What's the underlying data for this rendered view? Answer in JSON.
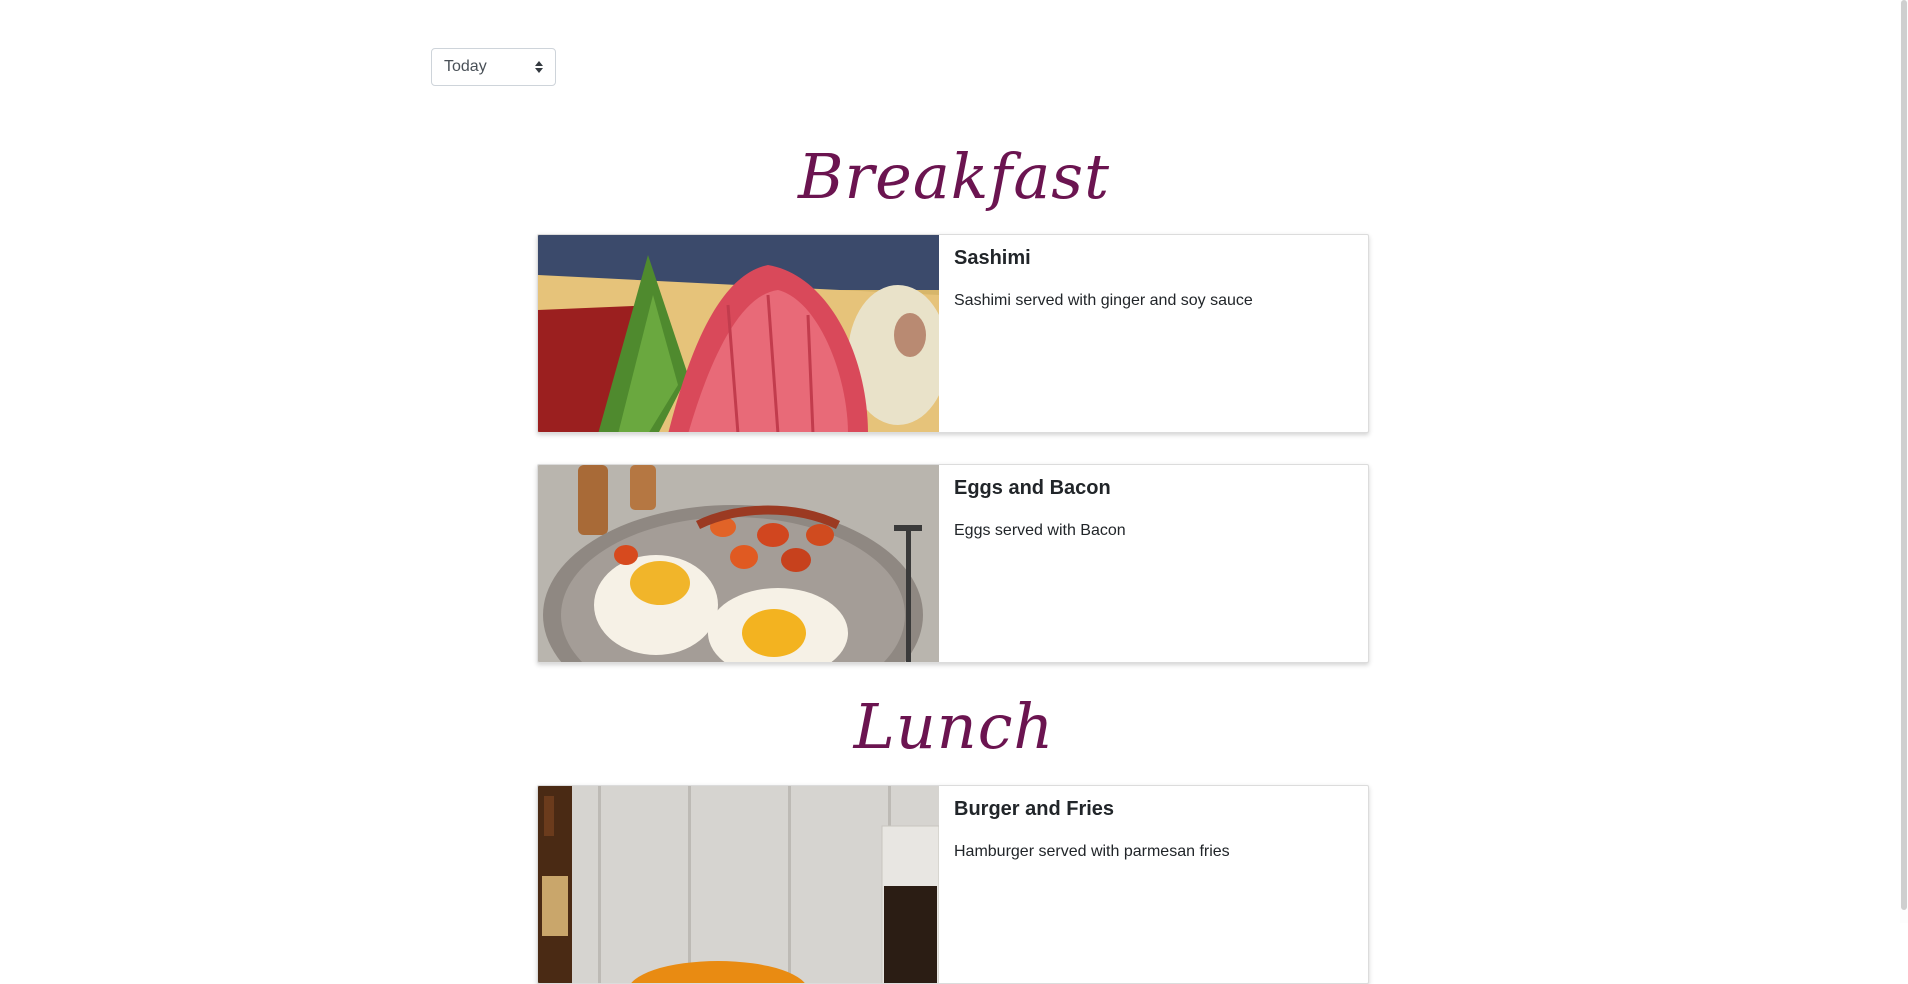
{
  "date_filter": {
    "selected": "Today"
  },
  "sections": [
    {
      "title": "Breakfast",
      "items": [
        {
          "name": "Sashimi",
          "description": "Sashimi served with ginger and soy sauce"
        },
        {
          "name": "Eggs and Bacon",
          "description": "Eggs served with Bacon"
        }
      ]
    },
    {
      "title": "Lunch",
      "items": [
        {
          "name": "Burger and Fries",
          "description": "Hamburger served with parmesan fries"
        }
      ]
    }
  ],
  "colors": {
    "heading": "#6b1450",
    "card_border": "#dcdcdc"
  }
}
